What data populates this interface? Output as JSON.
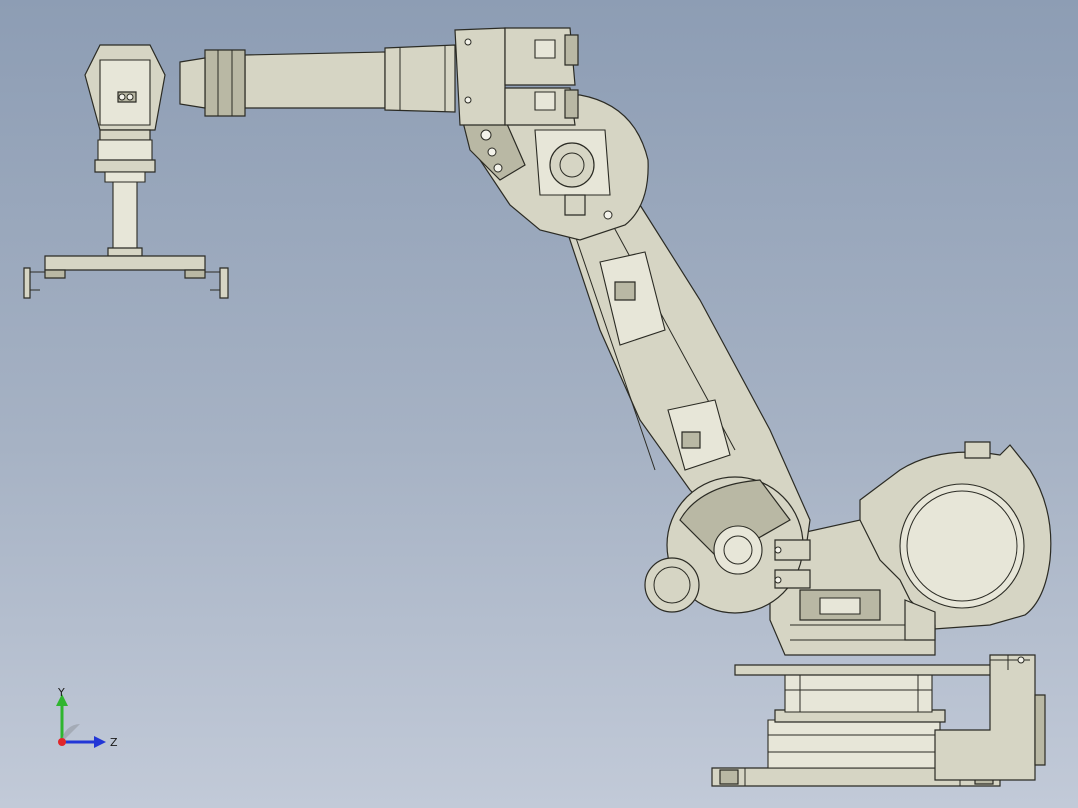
{
  "app": {
    "title": ""
  },
  "colors": {
    "background_top": "#8d9db4",
    "background_bottom": "#c2cad8",
    "model_fill": "#d6d5c4",
    "model_edge": "#2b2b24",
    "axis_x": "#e0262a",
    "axis_y": "#2fb52f",
    "axis_z": "#2236d6"
  },
  "triad": {
    "y_label": "Y",
    "z_label": "Z"
  },
  "model": {
    "name": "",
    "icon": "robot-arm-model"
  }
}
